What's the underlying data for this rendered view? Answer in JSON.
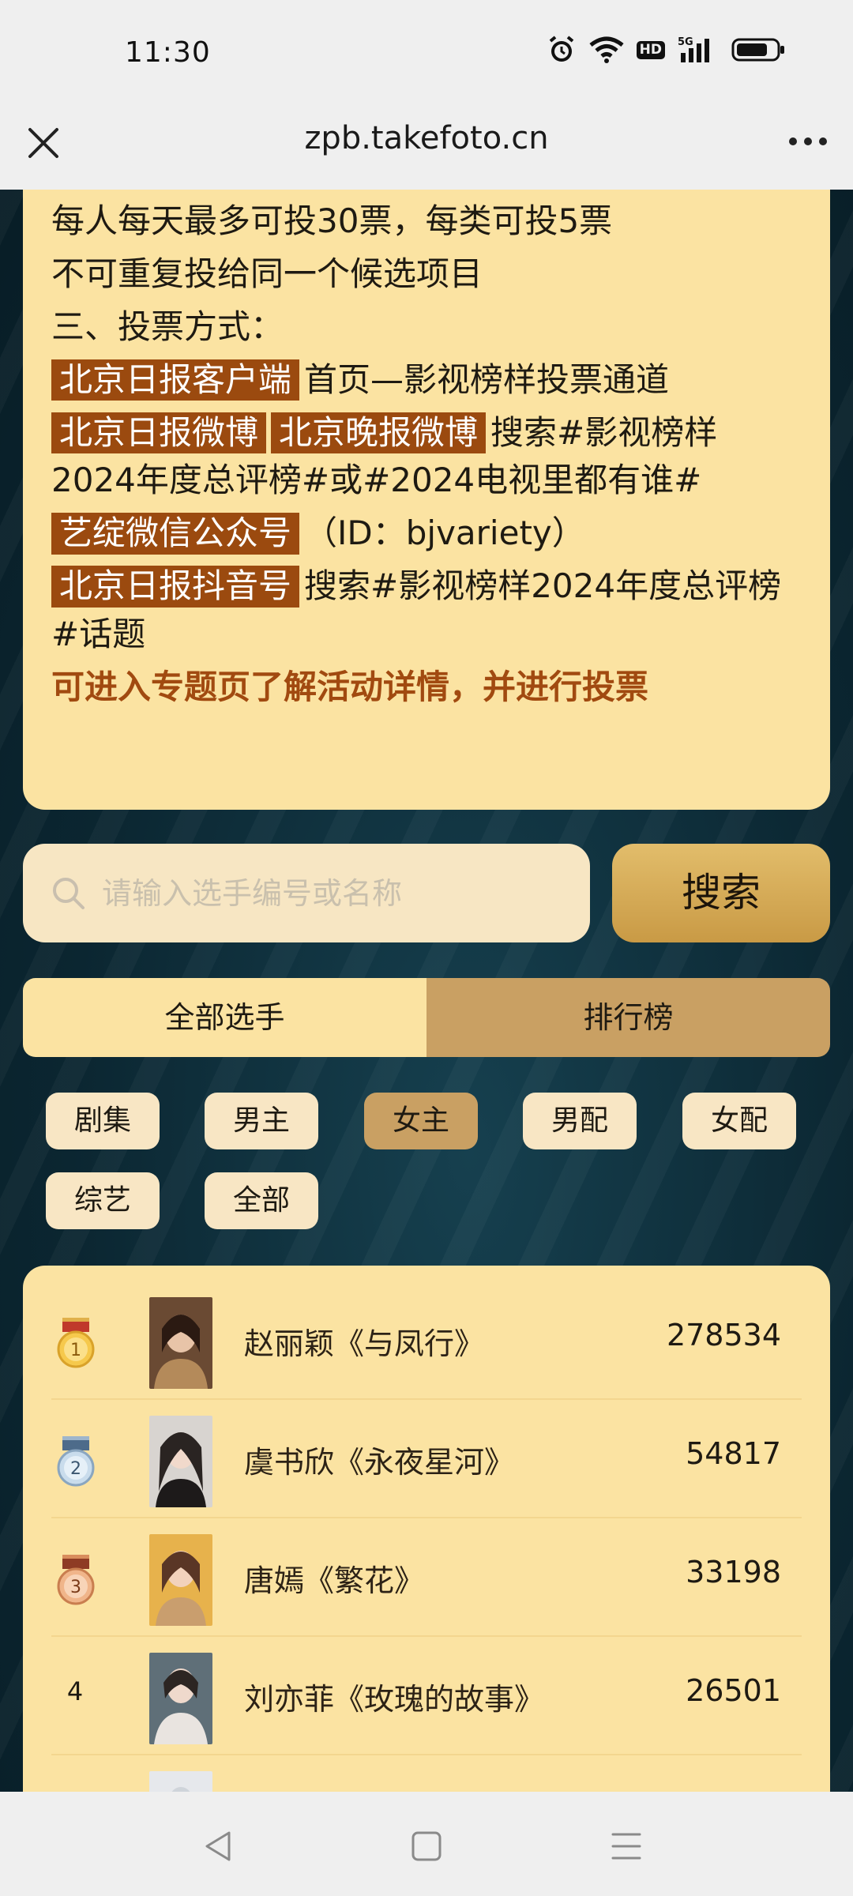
{
  "status_bar": {
    "time": "11:30",
    "icons": [
      "alarm-icon",
      "wifi-icon",
      "hd-icon",
      "5g-signal-icon",
      "battery-icon"
    ],
    "hd_label": "HD",
    "network_label": "5G"
  },
  "browser": {
    "url": "zpb.takefoto.cn",
    "close_icon": "close-icon",
    "more_icon": "more-icon"
  },
  "rules": {
    "line1": "每人每天最多可投30票，每类可投5票",
    "line2": "不可重复投给同一个候选项目",
    "section_title": "三、投票方式：",
    "channels": [
      {
        "tags": [
          "北京日报客户端"
        ],
        "text": "首页—影视榜样投票通道"
      },
      {
        "tags": [
          "北京日报微博",
          "北京晚报微博"
        ],
        "text": "搜索#影视榜样2024年度总评榜#或#2024电视里都有谁#"
      },
      {
        "tags": [
          "艺绽微信公众号"
        ],
        "text": "（ID：bjvariety）"
      },
      {
        "tags": [
          "北京日报抖音号"
        ],
        "text": "搜索#影视榜样2024年度总评榜#话题"
      }
    ],
    "highlight": "可进入专题页了解活动详情，并进行投票"
  },
  "search": {
    "placeholder": "请输入选手编号或名称",
    "value": "",
    "button_label": "搜索"
  },
  "tabs": [
    {
      "label": "全部选手",
      "active": false
    },
    {
      "label": "排行榜",
      "active": true
    }
  ],
  "categories": [
    {
      "label": "剧集",
      "selected": false
    },
    {
      "label": "男主",
      "selected": false
    },
    {
      "label": "女主",
      "selected": true
    },
    {
      "label": "男配",
      "selected": false
    },
    {
      "label": "女配",
      "selected": false
    },
    {
      "label": "综艺",
      "selected": false
    },
    {
      "label": "全部",
      "selected": false
    }
  ],
  "ranking": [
    {
      "rank": "1",
      "medal": "gold-medal-icon",
      "name": "赵丽颖《与凤行》",
      "votes": "278534"
    },
    {
      "rank": "2",
      "medal": "silver-medal-icon",
      "name": "虞书欣《永夜星河》",
      "votes": "54817"
    },
    {
      "rank": "3",
      "medal": "bronze-medal-icon",
      "name": "唐嫣《繁花》",
      "votes": "33198"
    },
    {
      "rank": "4",
      "medal": "",
      "name": "刘亦菲《玫瑰的故事》",
      "votes": "26501"
    }
  ],
  "colors": {
    "card_bg": "#fbe3a2",
    "tag_bg": "#9b4a0f",
    "highlight_text": "#a14a10",
    "active_tab": "#c9a063",
    "page_bg": "#0d2a36"
  },
  "nav": {
    "back_icon": "back-icon",
    "home_icon": "home-icon",
    "menu_icon": "menu-icon"
  }
}
